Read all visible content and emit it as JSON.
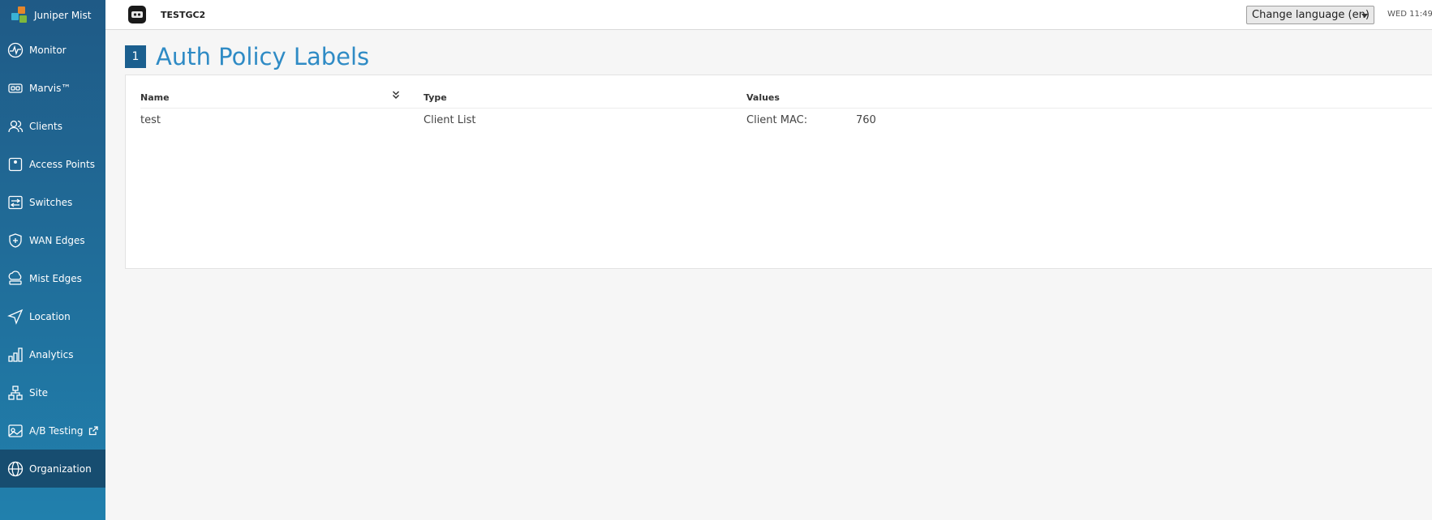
{
  "app": {
    "brand": "Juniper Mist"
  },
  "sidebar": {
    "items": [
      {
        "label": "Monitor",
        "icon": "monitor-icon"
      },
      {
        "label": "Marvis™",
        "icon": "marvis-icon"
      },
      {
        "label": "Clients",
        "icon": "clients-icon"
      },
      {
        "label": "Access Points",
        "icon": "access-point-icon"
      },
      {
        "label": "Switches",
        "icon": "switches-icon"
      },
      {
        "label": "WAN Edges",
        "icon": "wan-edges-icon"
      },
      {
        "label": "Mist Edges",
        "icon": "mist-edges-icon"
      },
      {
        "label": "Location",
        "icon": "location-icon"
      },
      {
        "label": "Analytics",
        "icon": "analytics-icon"
      },
      {
        "label": "Site",
        "icon": "site-icon"
      },
      {
        "label": "A/B Testing",
        "icon": "ab-testing-icon"
      },
      {
        "label": "Organization",
        "icon": "organization-icon",
        "active": true
      }
    ]
  },
  "header": {
    "org_name": "TESTGC2",
    "language": {
      "selected": "Change language (en)"
    },
    "clock": "WED 11:49"
  },
  "main": {
    "count": "1",
    "title": "Auth Policy Labels",
    "table": {
      "columns": [
        "Name",
        "Type",
        "Values"
      ],
      "rows": [
        {
          "name": "test",
          "type": "Client List",
          "value_label": "Client MAC:",
          "value": "760"
        }
      ]
    }
  },
  "colors": {
    "sidebar_top": "#1f5a86",
    "sidebar_bottom": "#2180ad",
    "sidebar_active": "#174d70",
    "accent": "#2f8bc5",
    "badge": "#1b5f8f"
  }
}
